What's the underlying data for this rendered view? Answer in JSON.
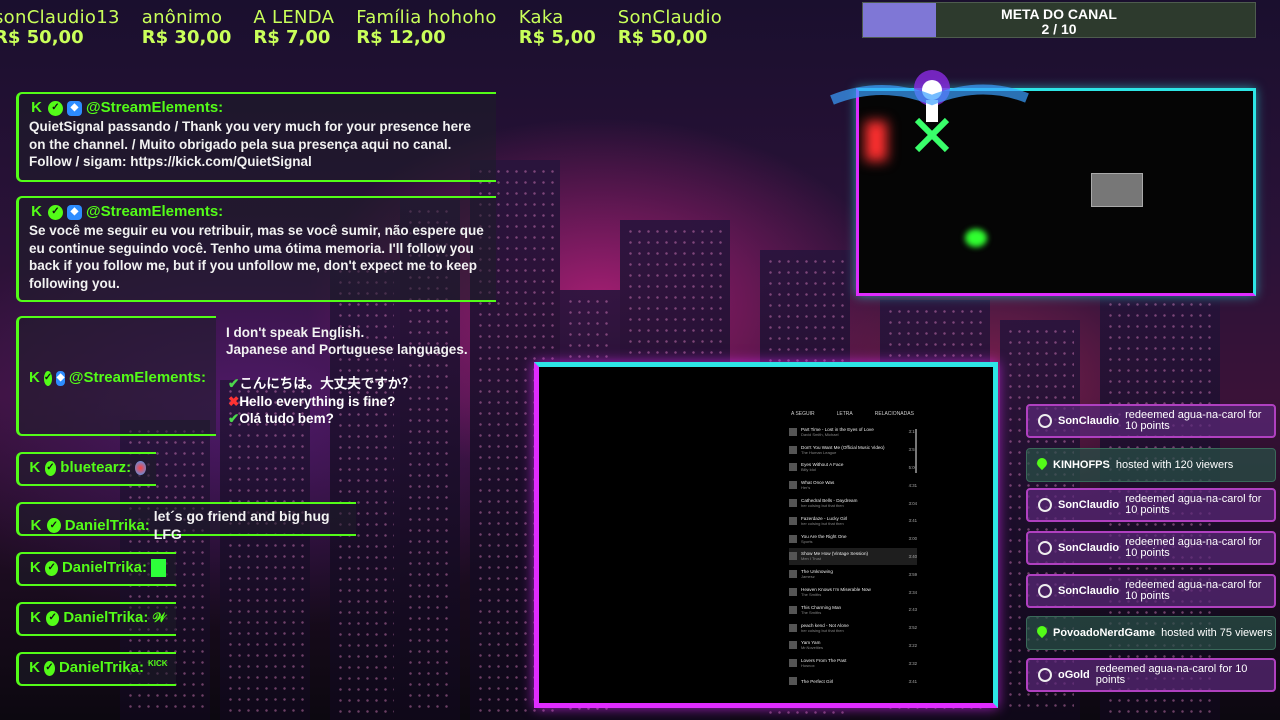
{
  "donations": [
    {
      "name": "sonClaudio13",
      "amount": "R$ 50,00"
    },
    {
      "name": "anônimo",
      "amount": "R$ 30,00"
    },
    {
      "name": "A LENDA",
      "amount": "R$ 7,00"
    },
    {
      "name": "Família hohoho",
      "amount": "R$ 12,00"
    },
    {
      "name": "Kaka",
      "amount": "R$ 5,00"
    },
    {
      "name": "SonClaudio",
      "amount": "R$ 50,00"
    }
  ],
  "goal": {
    "title": "META DO CANAL",
    "count": "2 / 10",
    "progress": 0.2
  },
  "chat": [
    {
      "user": "@StreamElements:",
      "text": "QuietSignal passando / Thank you very much for your presence here on the channel. / Muito obrigado pela sua presença aqui no canal. Follow / sigam: https://kick.com/QuietSignal"
    },
    {
      "user": "@StreamElements:",
      "text": "Se você me seguir eu vou retribuir, mas se você sumir, não espere que eu continue seguindo você. Tenho uma ótima memoria. I'll follow you back if you follow me, but if you unfollow me, don't expect me to keep following you."
    },
    {
      "user": "@StreamElements:",
      "note1": "I don't speak English.",
      "note2": "Japanese and Portuguese languages.",
      "lines": [
        "こんにちは。大丈夫ですか？",
        "Hello everything is fine?",
        "Olá tudo bem?"
      ]
    },
    {
      "user": "bluetearz:",
      "text": ""
    },
    {
      "user": "DanielTrika:",
      "text": "let´s go friend and big hug LFG"
    },
    {
      "user": "DanielTrika:",
      "text": ""
    },
    {
      "user": "DanielTrika:",
      "text": "𝒲"
    },
    {
      "user": "DanielTrika:",
      "text": ""
    }
  ],
  "player": {
    "tabs": [
      "A SEGUIR",
      "LETRA",
      "RELACIONADAS"
    ],
    "tracks": [
      {
        "title": "Part Time - Lost in the Eyes of Love",
        "artist": "David Smith, Michael",
        "dur": "3:15"
      },
      {
        "title": "Don't You Want Me (Official Music Video)",
        "artist": "The Human League",
        "dur": "3:57"
      },
      {
        "title": "Eyes Without A Face",
        "artist": "Billy Idol",
        "dur": "5:00"
      },
      {
        "title": "What Once Was",
        "artist": "Her's",
        "dur": "4:31"
      },
      {
        "title": "Cathedral Bells - Daydream",
        "artist": "her colsing but that then",
        "dur": "3:04"
      },
      {
        "title": "Fazerdaze - Lucky Girl",
        "artist": "her colsing but that then",
        "dur": "3:41"
      },
      {
        "title": "You Are the Right One",
        "artist": "Sports",
        "dur": "3:00"
      },
      {
        "title": "Show Me How (Vintage Session)",
        "artist": "Men I Trust",
        "dur": "3:40"
      },
      {
        "title": "The Unknowing",
        "artist": "Jamesz",
        "dur": "3:59"
      },
      {
        "title": "Heaven Knows I'm Miserable Now",
        "artist": "The Smiths",
        "dur": "3:34"
      },
      {
        "title": "This Charming Man",
        "artist": "The Smiths",
        "dur": "2:43"
      },
      {
        "title": "peach kend - Not Alone",
        "artist": "her colsing but that then",
        "dur": "3:52"
      },
      {
        "title": "Yam Yam",
        "artist": "Mr.Novelties",
        "dur": "3:22"
      },
      {
        "title": "Lovers From The Past",
        "artist": "Hosnox",
        "dur": "3:32"
      },
      {
        "title": "The Perfect Girl",
        "artist": "",
        "dur": "3:41"
      }
    ]
  },
  "events": [
    {
      "type": "redeem",
      "user": "SonClaudio",
      "text": "redeemed agua-na-carol for 10 points"
    },
    {
      "type": "host",
      "user": "KINHOFPS",
      "text": "hosted with 120 viewers"
    },
    {
      "type": "redeem",
      "user": "SonClaudio",
      "text": "redeemed agua-na-carol for 10 points"
    },
    {
      "type": "redeem",
      "user": "SonClaudio",
      "text": "redeemed agua-na-carol for 10 points"
    },
    {
      "type": "redeem",
      "user": "SonClaudio",
      "text": "redeemed agua-na-carol for 10 points"
    },
    {
      "type": "host",
      "user": "PovoadoNerdGame",
      "text": "hosted with 75 viewers"
    },
    {
      "type": "redeem",
      "user": "oGold",
      "text": "redeemed agua-na-carol for 10 points"
    }
  ],
  "colors": {
    "accent_green": "#53fc18",
    "accent_cyan": "#2de6e6",
    "accent_magenta": "#e02cff",
    "ticker": "#c9ff5a",
    "goal_fill": "#7f77d6"
  }
}
